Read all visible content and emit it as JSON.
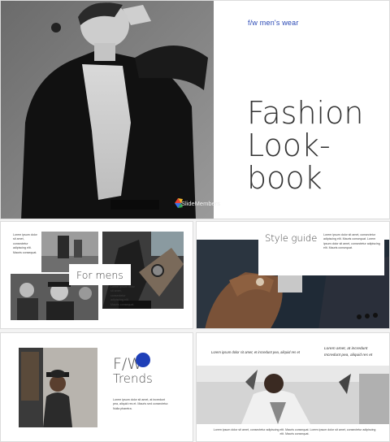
{
  "main": {
    "subtitle": "f/w men's wear",
    "title_lines": [
      "Fashion",
      "Look-",
      "book"
    ],
    "logo_text": "SlideMembers"
  },
  "slide_formens": {
    "label": "For mens",
    "text_top": "Lorem ipsum dolor sit amet, consectetur adipiscing elit. Mauris consequat.",
    "text_mid": "Lorem ipsum dolor sit amet, consectetur adipiscing elit. Mauris consequat."
  },
  "slide_style": {
    "label": "Style guide",
    "text": "Lorem ipsum dolor sit amet, consectetur adipiscing elit. Mauris consequat. Lorem ipsum dolor sit amet, consectetur adipiscing elit. Mauris consequat."
  },
  "slide_trends": {
    "fw": "F/W",
    "trends": "Trends",
    "text": "Lorem ipsum dolor sit amet, at incredunt pea, aliquid res et. Mauris sed consectetur. Nulla pharetra."
  },
  "slide_last": {
    "header_left": "Lorem ipsum dolor sit amet, et incredunt pea, aliquid res et",
    "header_right_1": "Lorem amet, at incredunt",
    "header_right_2": "Incredunt pea, aliquid res et",
    "footer": "Lorem ipsum dolor sit amet, consectetur adipiscing elit. Mauris consequat. Lorem ipsum dolor sit amet, consectetur adipiscing elit. Mauris consequat."
  },
  "colors": {
    "accent_blue": "#1e3fb8",
    "subtitle_blue": "#2a49b5"
  }
}
